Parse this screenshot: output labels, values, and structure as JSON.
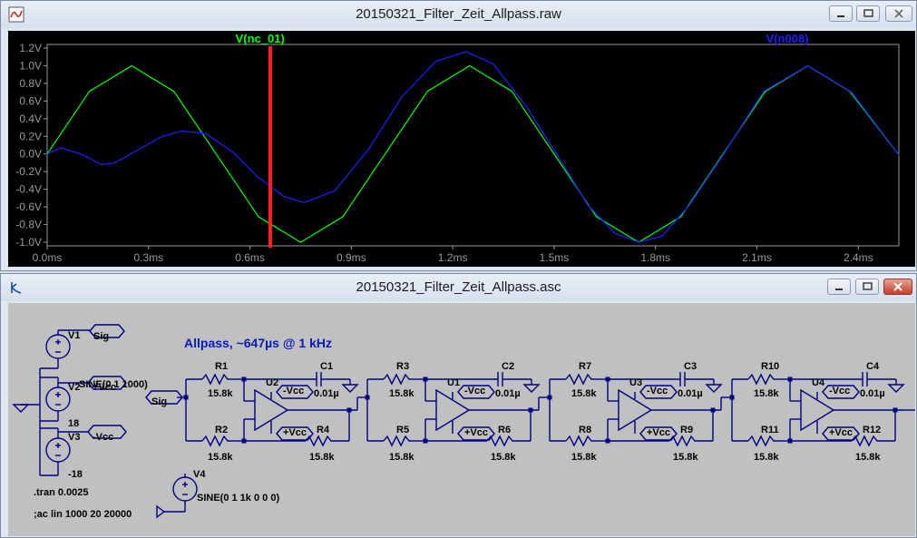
{
  "waveform_window": {
    "title": "20150321_Filter_Zeit_Allpass.raw"
  },
  "schematic_window": {
    "title": "20150321_Filter_Zeit_Allpass.asc"
  },
  "chart_data": {
    "type": "line",
    "xlim": [
      0.0,
      2.52
    ],
    "ylim": [
      -1.0,
      1.2
    ],
    "x_ticks": [
      "0.0ms",
      "0.3ms",
      "0.6ms",
      "0.9ms",
      "1.2ms",
      "1.5ms",
      "1.8ms",
      "2.1ms",
      "2.4ms"
    ],
    "y_ticks": [
      "1.2V",
      "1.0V",
      "0.8V",
      "0.6V",
      "0.4V",
      "0.2V",
      "0.0V",
      "-0.2V",
      "-0.4V",
      "-0.6V",
      "-0.8V",
      "-1.0V"
    ],
    "cursor_x": 0.66,
    "grid": false,
    "series": [
      {
        "name": "V(nc_01)",
        "color": "#00ff00",
        "x": [
          0.0,
          0.125,
          0.25,
          0.375,
          0.5,
          0.625,
          0.75,
          0.875,
          1.0,
          1.125,
          1.25,
          1.375,
          1.5,
          1.625,
          1.75,
          1.875,
          2.0,
          2.125,
          2.25,
          2.375,
          2.52
        ],
        "y": [
          0.0,
          0.71,
          1.0,
          0.71,
          0.0,
          -0.71,
          -1.0,
          -0.71,
          0.0,
          0.71,
          1.0,
          0.71,
          0.0,
          -0.71,
          -1.0,
          -0.71,
          0.0,
          0.71,
          1.0,
          0.71,
          -0.01
        ]
      },
      {
        "name": "V(n008)",
        "color": "#2020ff",
        "x": [
          0.0,
          0.04,
          0.1,
          0.16,
          0.2,
          0.27,
          0.34,
          0.4,
          0.47,
          0.55,
          0.62,
          0.7,
          0.76,
          0.85,
          0.95,
          1.05,
          1.15,
          1.24,
          1.32,
          1.42,
          1.52,
          1.6,
          1.68,
          1.75,
          1.82,
          1.9,
          2.0,
          2.12,
          2.25,
          2.38,
          2.52
        ],
        "y": [
          0.0,
          0.07,
          0.0,
          -0.12,
          -0.1,
          0.05,
          0.2,
          0.26,
          0.23,
          0.02,
          -0.25,
          -0.48,
          -0.55,
          -0.42,
          0.05,
          0.65,
          1.05,
          1.16,
          1.02,
          0.53,
          -0.08,
          -0.58,
          -0.9,
          -1.0,
          -0.93,
          -0.58,
          -0.01,
          0.71,
          1.0,
          0.7,
          -0.01
        ]
      }
    ]
  },
  "schematic": {
    "title_text": "Allpass, ~647µs @ 1 kHz",
    "sources": [
      {
        "name": "V1",
        "net": "Sig",
        "value": "SINE(0 1 1000)"
      },
      {
        "name": "V2",
        "net": "+Vcc",
        "value": "18"
      },
      {
        "name": "V3",
        "net": "-Vcc",
        "value": "-18"
      },
      {
        "name": "V4",
        "value": "SINE(0 1 1k 0 0 0)"
      }
    ],
    "directives": [
      ".tran 0.0025",
      ";ac lin 1000 20 20000"
    ],
    "input_net": "Sig",
    "vneg": "-Vcc",
    "vpos": "+Vcc",
    "stages": [
      {
        "ra": "R1",
        "rb": "R2",
        "rf": "R4",
        "c": "C1",
        "u": "U2",
        "r_val": "15.8k",
        "c_val": "0.01µ"
      },
      {
        "ra": "R3",
        "rb": "R5",
        "rf": "R6",
        "c": "C2",
        "u": "U1",
        "r_val": "15.8k",
        "c_val": "0.01µ"
      },
      {
        "ra": "R7",
        "rb": "R8",
        "rf": "R9",
        "c": "C3",
        "u": "U3",
        "r_val": "15.8k",
        "c_val": "0.01µ"
      },
      {
        "ra": "R10",
        "rb": "R11",
        "rf": "R12",
        "c": "C4",
        "u": "U4",
        "r_val": "15.8k",
        "c_val": "0.01µ"
      }
    ]
  }
}
